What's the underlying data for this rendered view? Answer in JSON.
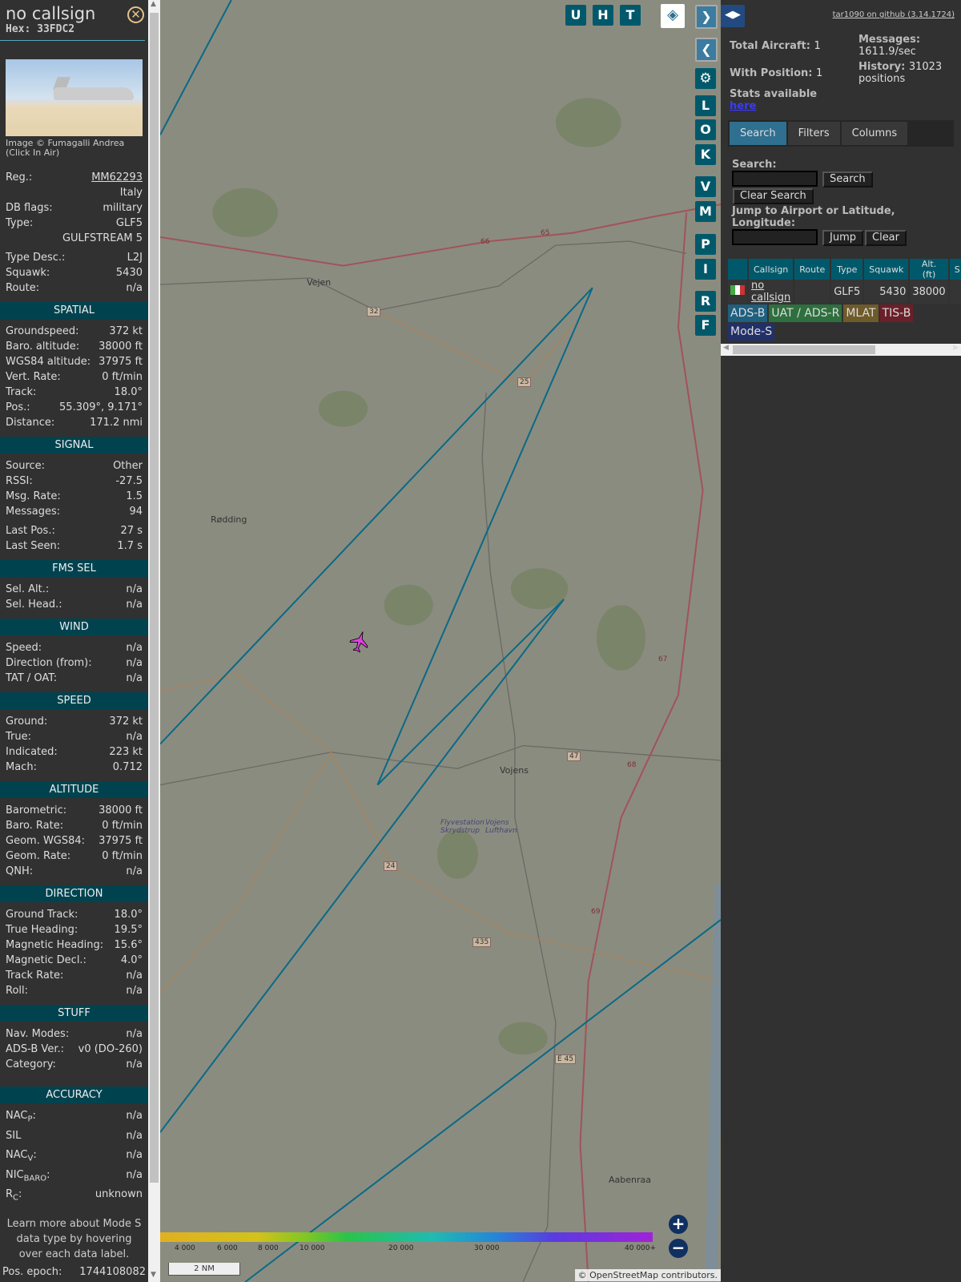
{
  "detail": {
    "title": "no callsign",
    "hex": "Hex: 33FDC2",
    "close_icon": "close-circle-icon",
    "photo_credit": "Image © Fumagalli Andrea (Click In Air)",
    "top_rows": [
      [
        "Reg.:",
        "MM62293"
      ],
      [
        "",
        "Italy"
      ],
      [
        "DB flags:",
        "military"
      ],
      [
        "Type:",
        "GLF5"
      ],
      [
        "",
        "GULFSTREAM 5"
      ],
      [
        "Type Desc.:",
        "L2J"
      ],
      [
        "Squawk:",
        "5430"
      ],
      [
        "Route:",
        "n/a"
      ]
    ],
    "sections": [
      {
        "title": "SPATIAL",
        "rows": [
          [
            "Groundspeed:",
            "372 kt"
          ],
          [
            "Baro. altitude:",
            "38000 ft"
          ],
          [
            "WGS84 altitude:",
            "37975 ft"
          ],
          [
            "Vert. Rate:",
            "0 ft/min"
          ],
          [
            "Track:",
            "18.0°"
          ],
          [
            "Pos.:",
            "55.309°, 9.171°"
          ],
          [
            "Distance:",
            "171.2 nmi"
          ]
        ]
      },
      {
        "title": "SIGNAL",
        "rows": [
          [
            "Source:",
            "Other"
          ],
          [
            "RSSI:",
            "-27.5"
          ],
          [
            "Msg. Rate:",
            "1.5"
          ],
          [
            "Messages:",
            "94"
          ],
          [
            "Last Pos.:",
            "27 s"
          ],
          [
            "Last Seen:",
            "1.7 s"
          ]
        ]
      },
      {
        "title": "FMS SEL",
        "rows": [
          [
            "Sel. Alt.:",
            "n/a"
          ],
          [
            "Sel. Head.:",
            "n/a"
          ]
        ]
      },
      {
        "title": "WIND",
        "rows": [
          [
            "Speed:",
            "n/a"
          ],
          [
            "Direction (from):",
            "n/a"
          ],
          [
            "TAT / OAT:",
            "n/a"
          ]
        ]
      },
      {
        "title": "SPEED",
        "rows": [
          [
            "Ground:",
            "372 kt"
          ],
          [
            "True:",
            "n/a"
          ],
          [
            "Indicated:",
            "223 kt"
          ],
          [
            "Mach:",
            "0.712"
          ]
        ]
      },
      {
        "title": "ALTITUDE",
        "rows": [
          [
            "Barometric:",
            "38000 ft"
          ],
          [
            "Baro. Rate:",
            "0 ft/min"
          ],
          [
            "Geom. WGS84:",
            "37975 ft"
          ],
          [
            "Geom. Rate:",
            "0 ft/min"
          ],
          [
            "QNH:",
            "n/a"
          ]
        ]
      },
      {
        "title": "DIRECTION",
        "rows": [
          [
            "Ground Track:",
            "18.0°"
          ],
          [
            "True Heading:",
            "19.5°"
          ],
          [
            "Magnetic Heading:",
            "15.6°"
          ],
          [
            "Magnetic Decl.:",
            "4.0°"
          ],
          [
            "Track Rate:",
            "n/a"
          ],
          [
            "Roll:",
            "n/a"
          ]
        ]
      },
      {
        "title": "STUFF",
        "rows": [
          [
            "Nav. Modes:",
            "n/a"
          ],
          [
            "ADS-B Ver.:",
            "v0 (DO-260)"
          ],
          [
            "Category:",
            "n/a"
          ]
        ]
      },
      {
        "title": "ACCURACY",
        "rows": [
          [
            "NAC",
            "P",
            ":",
            "n/a"
          ],
          [
            "SIL",
            "",
            "",
            "n/a"
          ],
          [
            "NAC",
            "V",
            ":",
            "n/a"
          ],
          [
            "NIC",
            "BARO",
            ":",
            "n/a"
          ],
          [
            "R",
            "C",
            ":",
            "unknown"
          ]
        ]
      }
    ],
    "note": "Learn more about Mode S data type by hovering over each data label.",
    "epoch_label": "Pos. epoch:",
    "epoch_value": "1744108082"
  },
  "map": {
    "top_buttons": [
      "U",
      "H",
      "T"
    ],
    "side_buttons": [
      "L",
      "O",
      "K",
      "V",
      "M",
      "P",
      "I",
      "R",
      "F"
    ],
    "places": [
      "Vejen",
      "Rødding",
      "Vojens",
      "Aabenraa",
      "Flyvestation Skrydstrup",
      "Vojens Lufthavn"
    ],
    "roads": [
      "32",
      "25",
      "47",
      "24",
      "435",
      "E 45",
      "65",
      "66",
      "67",
      "68",
      "69"
    ],
    "altitude_scale": [
      "4 000",
      "6 000",
      "8 000",
      "10 000",
      "20 000",
      "30 000",
      "40 000+"
    ],
    "scale_bar": "2 NM",
    "attribution": "© OpenStreetMap contributors.",
    "aircraft_color": "#e040e0",
    "track_color": "#0b6a86"
  },
  "stats": {
    "github": "tar1090 on github (3.14.1724)",
    "total_label": "Total Aircraft:",
    "total": "1",
    "pos_label": "With Position:",
    "pos": "1",
    "msg_label": "Messages:",
    "msg": "1611.9/sec",
    "hist_label": "History:",
    "hist": "31023 positions",
    "stats_label": "Stats available",
    "stats_link": "here"
  },
  "tabs": [
    "Search",
    "Filters",
    "Columns"
  ],
  "search": {
    "label": "Search:",
    "value": "",
    "search_btn": "Search",
    "clear_btn": "Clear Search",
    "jump_label": "Jump to Airport or Latitude, Longitude:",
    "jump_value": "",
    "jump_btn": "Jump",
    "clear2_btn": "Clear"
  },
  "table": {
    "headers": [
      "",
      "Callsign",
      "Route",
      "Type",
      "Squawk",
      "Alt. (ft)",
      "S"
    ],
    "rows": [
      [
        "",
        "no callsign",
        "",
        "GLF5",
        "5430",
        "38000",
        ""
      ]
    ]
  },
  "legend": [
    {
      "label": "ADS-B",
      "color": "#1f5f7f"
    },
    {
      "label": "UAT / ADS-R",
      "color": "#2e6f3e"
    },
    {
      "label": "MLAT",
      "color": "#6f5a2a"
    },
    {
      "label": "TIS-B",
      "color": "#6a1f2a"
    },
    {
      "label": "Mode-S",
      "color": "#22306a"
    }
  ]
}
